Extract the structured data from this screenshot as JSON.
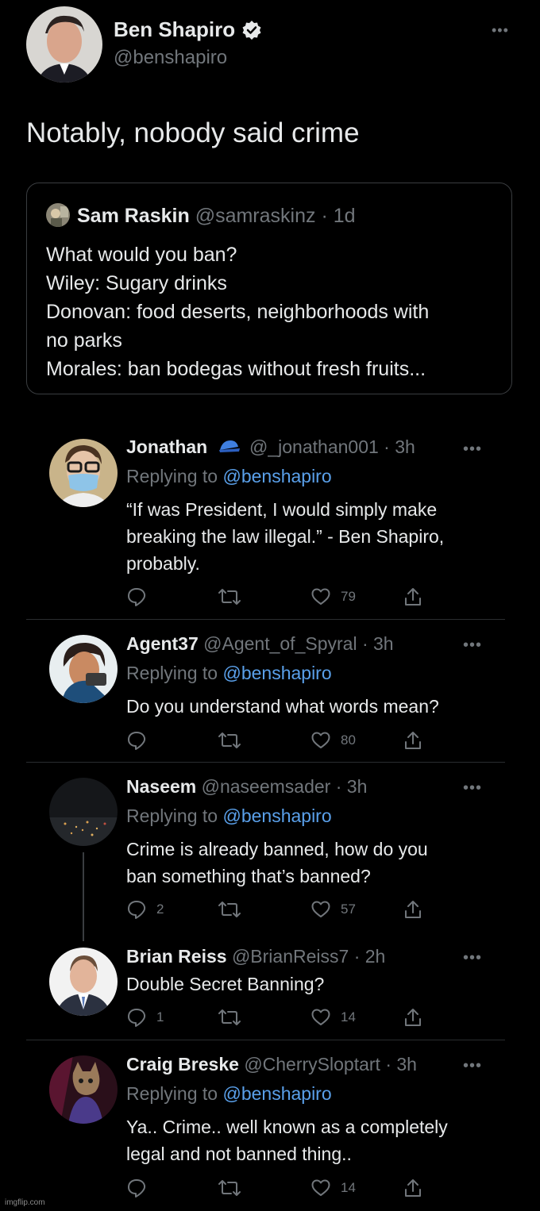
{
  "main_tweet": {
    "author": "Ben Shapiro",
    "handle": "@benshapiro",
    "text": "Notably, nobody said crime",
    "more": "•••"
  },
  "quoted_tweet": {
    "author": "Sam Raskin",
    "handle": "@samraskinz",
    "time": "· 1d",
    "lines": [
      "What would you ban?",
      "Wiley: Sugary drinks",
      "Donovan: food deserts, neighborhoods with",
      "no parks",
      "Morales: ban bodegas without fresh fruits..."
    ]
  },
  "replying_prefix": "Replying to",
  "replies": [
    {
      "author": "Jonathan",
      "handle": "@_jonathan001",
      "time": "· 3h",
      "replying_to": "@benshapiro",
      "text": "“If was President, I would simply make\nbreaking the law illegal.” - Ben Shapiro,\nprobably.",
      "reply_count": "",
      "like_count": "79"
    },
    {
      "author": "Agent37",
      "handle": "@Agent_of_Spyral",
      "time": "· 3h",
      "replying_to": "@benshapiro",
      "text": "Do you understand what words mean?",
      "reply_count": "",
      "like_count": "80"
    },
    {
      "author": "Naseem",
      "handle": "@naseemsader",
      "time": "· 3h",
      "replying_to": "@benshapiro",
      "text": "Crime is already banned, how do you\nban something that’s banned?",
      "reply_count": "2",
      "like_count": "57"
    },
    {
      "author": "Brian Reiss",
      "handle": "@BrianReiss7",
      "time": "· 2h",
      "replying_to": "",
      "text": "Double Secret Banning?",
      "reply_count": "1",
      "like_count": "14"
    },
    {
      "author": "Craig Breske",
      "handle": "@CherrySloptart",
      "time": "· 3h",
      "replying_to": "@benshapiro",
      "text": "Ya.. Crime.. well known as a completely\nlegal and not banned thing..",
      "reply_count": "",
      "like_count": "14"
    }
  ],
  "watermark": "imgflip.com",
  "colors": {
    "background": "#000000",
    "text": "#e7e9ea",
    "secondary": "#71767b",
    "link": "#5aa0ea",
    "divider": "#2a2d30"
  }
}
